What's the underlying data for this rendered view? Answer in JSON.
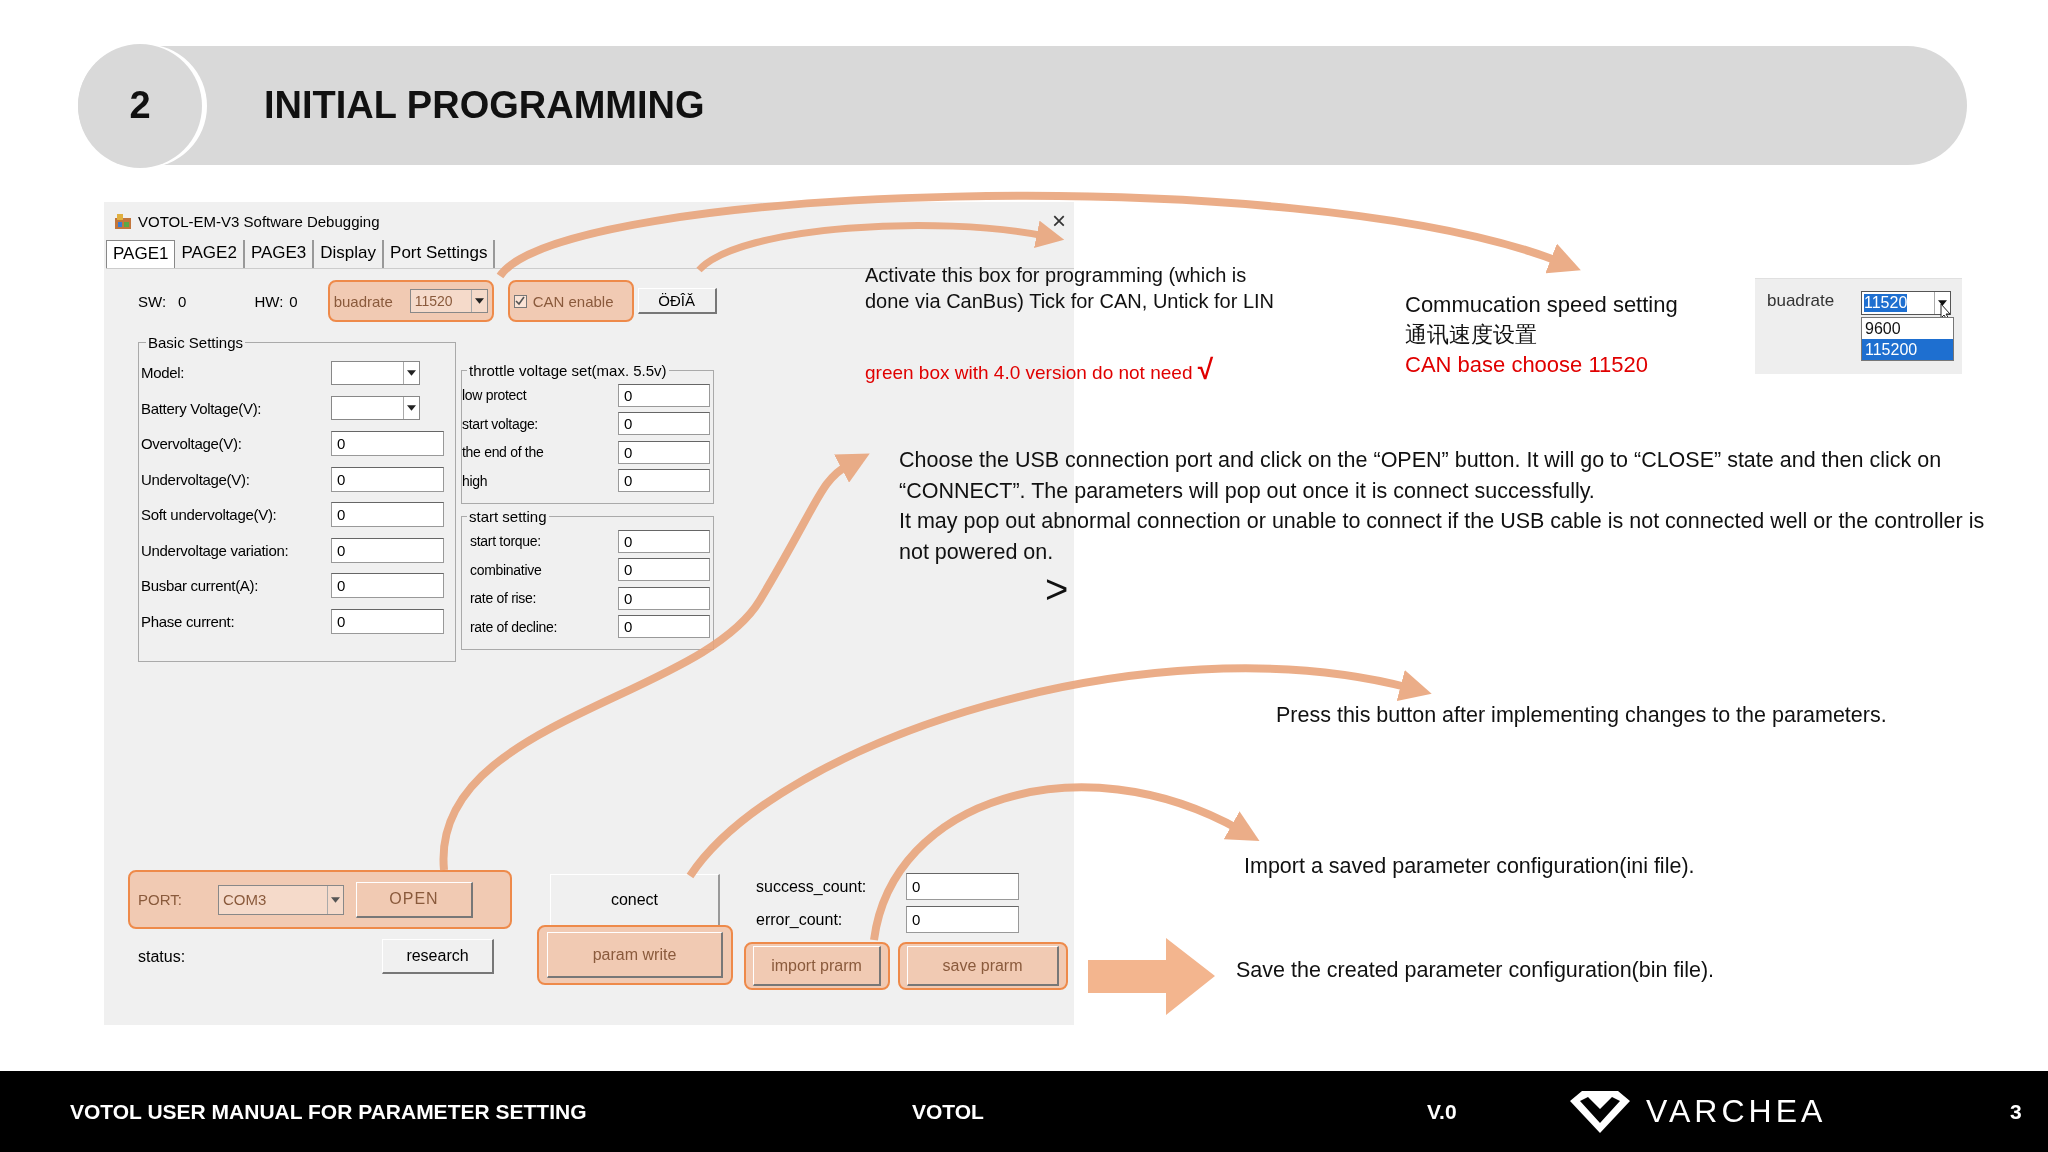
{
  "slide": {
    "number": "2",
    "title": "INITIAL PROGRAMMING"
  },
  "window": {
    "title": "VOTOL-EM-V3 Software Debugging",
    "close": "×",
    "tabs": [
      {
        "label": "PAGE1",
        "selected": true
      },
      {
        "label": "PAGE2",
        "selected": false
      },
      {
        "label": "PAGE3",
        "selected": false
      },
      {
        "label": "Display",
        "selected": false
      },
      {
        "label": "Port Settings",
        "selected": false
      }
    ],
    "sw": {
      "label": "SW:",
      "value": "0"
    },
    "hw": {
      "label": "HW:",
      "value": "0"
    },
    "baudrate": {
      "label": "buadrate",
      "value": "11520",
      "highlighted": true
    },
    "can_enable": {
      "label": "CAN enable",
      "checked": true,
      "highlighted": true
    },
    "garbled_button": "ÖĐÎĂ",
    "basic_settings": {
      "title": "Basic Settings",
      "fields": [
        {
          "label": "Model:",
          "kind": "dropdown"
        },
        {
          "label": "Battery Voltage(V):",
          "kind": "dropdown"
        },
        {
          "label": "Overvoltage(V):",
          "kind": "input",
          "value": "0"
        },
        {
          "label": "Undervoltage(V):",
          "kind": "input",
          "value": "0"
        },
        {
          "label": "Soft undervoltage(V):",
          "kind": "input",
          "value": "0"
        },
        {
          "label": "Undervoltage variation:",
          "kind": "input",
          "value": "0"
        },
        {
          "label": "Busbar current(A):",
          "kind": "input",
          "value": "0"
        },
        {
          "label": "Phase current:",
          "kind": "input",
          "value": "0"
        }
      ]
    },
    "throttle": {
      "title": "throttle voltage set(max. 5.5v)",
      "fields": [
        {
          "label": "low protect",
          "value": "0"
        },
        {
          "label": "start voltage:",
          "value": "0"
        },
        {
          "label": "the end of the",
          "value": "0"
        },
        {
          "label": "high",
          "value": "0"
        }
      ]
    },
    "start_setting": {
      "title": "start setting",
      "fields": [
        {
          "label": "start torque:",
          "value": "0"
        },
        {
          "label": "combinative",
          "value": "0"
        },
        {
          "label": "rate of rise:",
          "value": "0"
        },
        {
          "label": "rate of decline:",
          "value": "0"
        }
      ]
    },
    "port": {
      "label": "PORT:",
      "value": "COM3",
      "button": "OPEN",
      "highlighted": true
    },
    "connect_button": "conect",
    "counts": [
      {
        "label": "success_count:",
        "value": "0"
      },
      {
        "label": "error_count:",
        "value": "0"
      }
    ],
    "status": {
      "label": "status:"
    },
    "research_button": "research",
    "write_button": {
      "label": "param write",
      "highlighted": true
    },
    "file_buttons": [
      {
        "label": "import prarm",
        "highlighted": true
      },
      {
        "label": "save prarm",
        "highlighted": true
      }
    ]
  },
  "annotations": {
    "can_note": "Activate this box for programming (which is done via CanBus) Tick for CAN, Untick for LIN",
    "can_warning": "green box with 4.0 version do not need **√**",
    "speed_note": [
      "Commucation speed setting",
      "通讯速度设置"
    ],
    "speed_warning": "CAN base choose 11520",
    "baud_inset": {
      "label": "buadrate",
      "value": "11520",
      "options": [
        {
          "label": "9600",
          "selected": false
        },
        {
          "label": "115200",
          "selected": true
        }
      ]
    },
    "usb_note": [
      "Choose the USB connection port and click on the “OPEN” button. It will go to “CLOSE” state and then click on “CONNECT”. The parameters will pop out once it is connect successfully.",
      "It may pop out abnormal connection or unable to connect if the USB cable is not connected well or the controller is not powered on."
    ],
    "next_mark": ">",
    "write_note": "Press this button after implementing changes to the parameters.",
    "import_note": "Import a saved parameter configuration(ini file).",
    "save_note": "Save the created parameter configuration(bin file)."
  },
  "footer": {
    "title": "VOTOL USER MANUAL FOR PARAMETER SETTING",
    "brand": "VOTOL",
    "version": "V.0",
    "logo": "VARCHEA",
    "page": "3"
  }
}
